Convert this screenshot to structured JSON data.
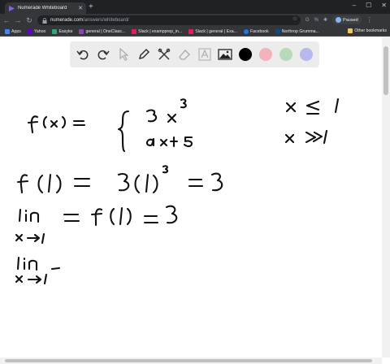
{
  "browser": {
    "tab_title": "Numerade Whiteboard",
    "url_host": "numerade.com",
    "url_path": "/answers/whiteboard/",
    "profile_name": "Paused",
    "new_tab_symbol": "+",
    "window_controls": [
      "–",
      "☐",
      "✕"
    ],
    "extensions": [
      "G",
      "%",
      "✱"
    ]
  },
  "bookmarks": [
    {
      "label": "Apps",
      "color": "#4285f4"
    },
    {
      "label": "Yahoo",
      "color": "#6001d2"
    },
    {
      "label": "Easyke",
      "color": "#2aa876"
    },
    {
      "label": "general | OneClass...",
      "color": "#8e44ad"
    },
    {
      "label": "Slack | exampprep_in...",
      "color": "#e01e5a"
    },
    {
      "label": "Slack | general | Exa...",
      "color": "#e01e5a"
    },
    {
      "label": "Facebook",
      "color": "#1877f2"
    },
    {
      "label": "Northrop Grumma...",
      "color": "#0a4a8a"
    }
  ],
  "other_bookmarks": "Other bookmarks",
  "whiteboard_tools": [
    {
      "name": "undo-icon"
    },
    {
      "name": "redo-icon"
    },
    {
      "name": "cursor-icon"
    },
    {
      "name": "pen-icon"
    },
    {
      "name": "tools-icon"
    },
    {
      "name": "eraser-icon"
    },
    {
      "name": "text-icon"
    },
    {
      "name": "image-icon"
    }
  ],
  "colors": [
    "#000000",
    "#f2b3bc",
    "#b7dab9",
    "#b7b8ee"
  ],
  "handwriting": {
    "line1_lhs": "f(x) =",
    "line1_case1": "3x³",
    "line1_case1_cond": "x ≤ 1",
    "line1_case2": "ax + 5",
    "line1_case2_cond": "x > 1",
    "line2": "f(1) = 3(1)³ = 3",
    "line3": "lim f(x) = f(1) = 3",
    "line3_sub": "x→1",
    "line4": "lim⁻",
    "line4_sub": "x→1"
  }
}
